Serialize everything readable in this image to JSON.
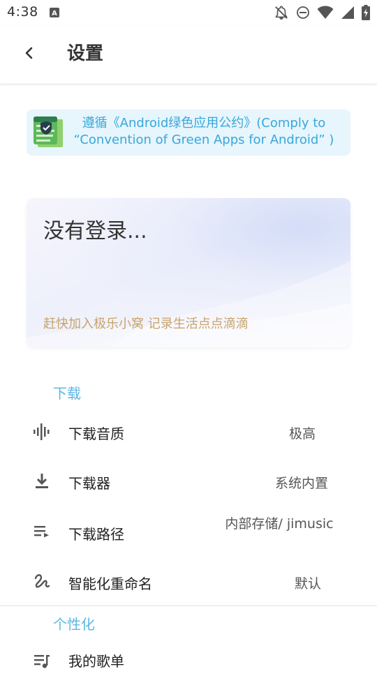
{
  "status_bar": {
    "time": "4:38",
    "icons": [
      "a-notification-icon",
      "notifications-off-icon",
      "do-not-disturb-icon",
      "wifi-icon",
      "signal-icon",
      "battery-charging-icon"
    ]
  },
  "app_bar": {
    "back_icon": "chevron-left-icon",
    "title": "设置"
  },
  "banner": {
    "icon": "green-apps-scroll-icon",
    "line1": "遵循《Android绿色应用公约》(Comply to",
    "line2": "“Convention of Green Apps for Android” )"
  },
  "login_card": {
    "title": "没有登录...",
    "subtitle": "赶快加入极乐小窝 记录生活点点滴滴"
  },
  "sections": [
    {
      "header": "下载",
      "items": [
        {
          "icon": "audio-waveform-icon",
          "label": "下载音质",
          "value": "极高"
        },
        {
          "icon": "download-icon",
          "label": "下载器",
          "value": "系统内置"
        },
        {
          "icon": "playlist-path-icon",
          "label": "下载路径",
          "value": "内部存储/ jimusic"
        },
        {
          "icon": "squiggle-rename-icon",
          "label": "智能化重命名",
          "value": "默认"
        }
      ]
    },
    {
      "header": "个性化",
      "items": [
        {
          "icon": "playlist-music-icon",
          "label": "我的歌单",
          "value": ""
        }
      ]
    }
  ],
  "colors": {
    "accent_blue": "#5fb7e1",
    "banner_bg": "#e7f5fd",
    "banner_text": "#37a8da",
    "login_subtitle": "#c8a36b"
  }
}
